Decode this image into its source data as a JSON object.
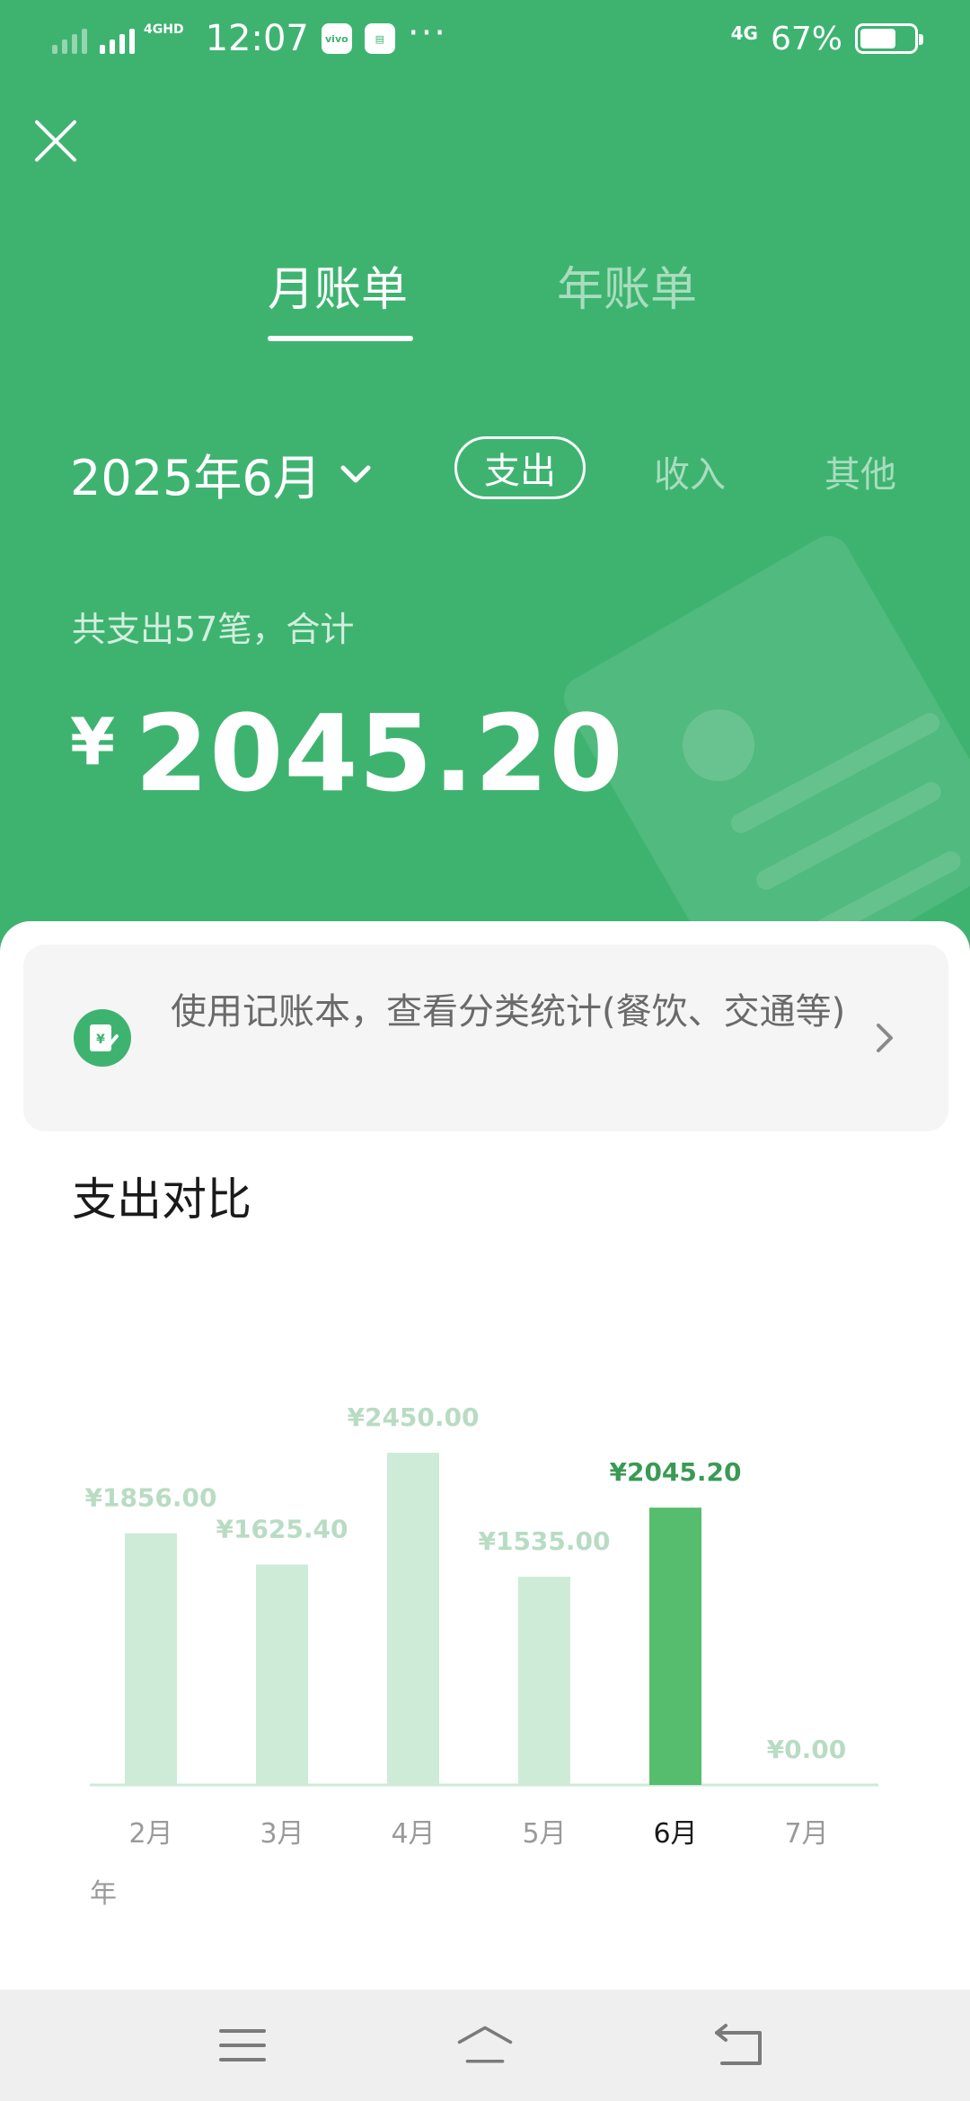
{
  "status_bar": {
    "time": "12:07",
    "network_label": "4GHD",
    "network_right": "4G",
    "battery_percent": "67%",
    "battery_level": 0.67,
    "more": "···"
  },
  "tabs": [
    {
      "label": "月账单",
      "active": true
    },
    {
      "label": "年账单",
      "active": false
    }
  ],
  "filter": {
    "month": "2025年6月",
    "types": [
      {
        "label": "支出",
        "active": true
      },
      {
        "label": "收入",
        "active": false
      },
      {
        "label": "其他",
        "active": false
      }
    ]
  },
  "summary": {
    "text": "共支出57笔，合计",
    "currency": "¥",
    "amount": "2045.20"
  },
  "notebook_banner": {
    "text": "使用记账本，查看分类统计(餐饮、交通等)"
  },
  "section_title": "支出对比",
  "chart_data": {
    "type": "bar",
    "categories": [
      "2月",
      "3月",
      "4月",
      "5月",
      "6月",
      "7月"
    ],
    "values": [
      1856.0,
      1625.4,
      2450.0,
      1535.0,
      2045.2,
      0.0
    ],
    "labels": [
      "¥1856.00",
      "¥1625.40",
      "¥2450.00",
      "¥1535.00",
      "¥2045.20",
      "¥0.00"
    ],
    "highlight_index": 4,
    "ylim": [
      0,
      2450
    ],
    "xlabel": "",
    "ylabel": "",
    "year_label": "年",
    "colors": {
      "highlight": "#55bd6d",
      "normal": "#cdebd6",
      "highlight_label": "#3a9a55",
      "normal_label": "#b8dcc3"
    }
  },
  "colors": {
    "brand_green": "#3eb370"
  }
}
